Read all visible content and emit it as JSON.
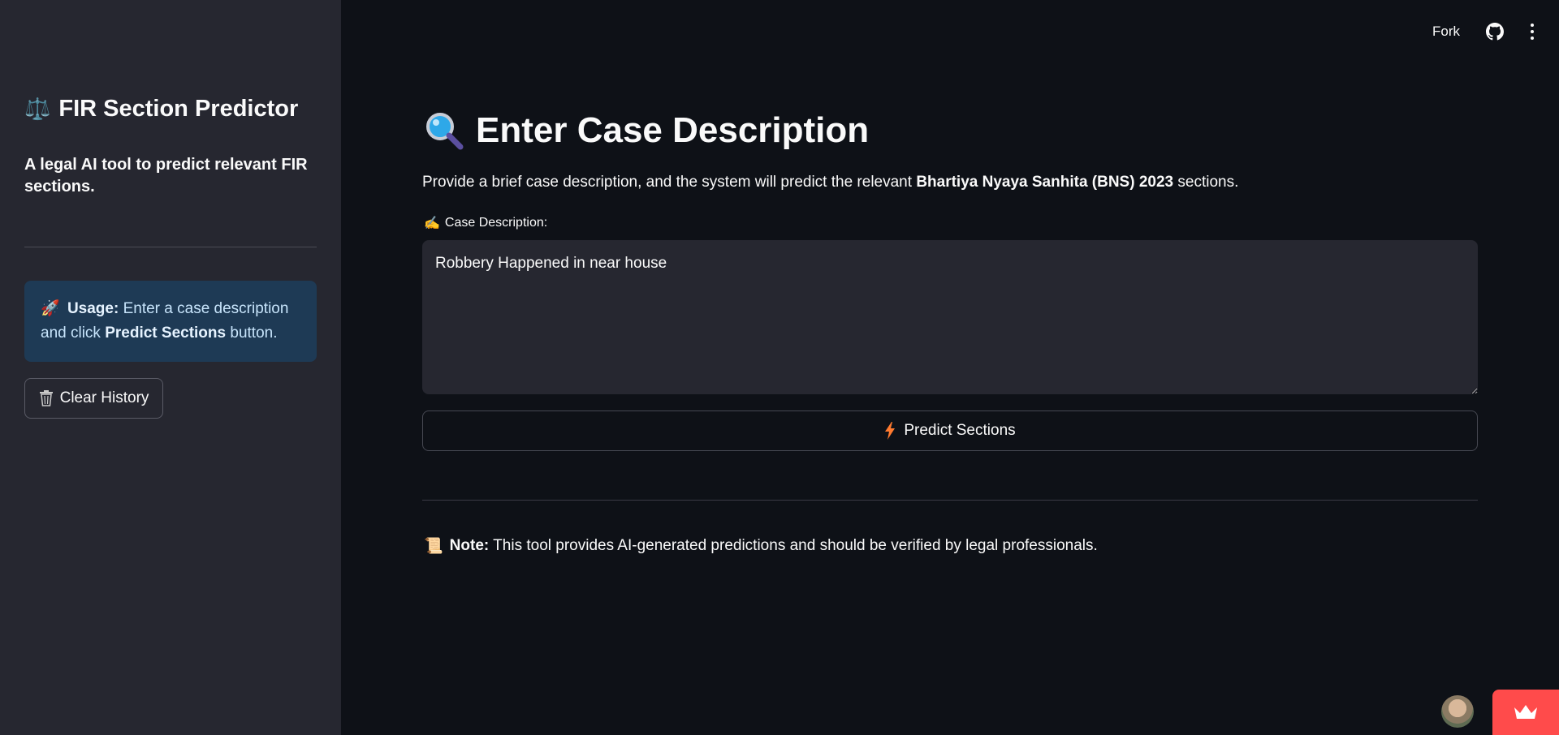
{
  "sidebar": {
    "title_emoji": "⚖️",
    "title": "FIR Section Predictor",
    "subtitle": "A legal AI tool to predict relevant FIR sections.",
    "usage": {
      "emoji": "🚀",
      "bold_label": "Usage:",
      "text_before": "Enter a case description and click",
      "bold_action": "Predict Sections",
      "text_after": "button."
    },
    "clear_button_label": "Clear History"
  },
  "topbar": {
    "fork_label": "Fork"
  },
  "main": {
    "title": "Enter Case Description",
    "description_prefix": "Provide a brief case description, and the system will predict the relevant",
    "description_bold": "Bhartiya Nyaya Sanhita (BNS) 2023",
    "description_suffix": "sections.",
    "field_label_emoji": "✍️",
    "field_label": "Case Description:",
    "case_text": "Robbery Happened in near house",
    "predict_button_label": "Predict Sections",
    "note_emoji": "📜",
    "note_bold": "Note:",
    "note_text": "This tool provides AI-generated predictions and should be verified by legal professionals."
  },
  "colors": {
    "background": "#0e1117",
    "sidebar": "#262730",
    "info_box": "#1e3a55",
    "accent_red": "#ff4b4b",
    "bolt_orange": "#ff7a2f"
  },
  "icons": [
    "balance-scale-icon",
    "rocket-icon",
    "trash-icon",
    "github-icon",
    "kebab-menu-icon",
    "magnifying-glass-icon",
    "writing-hand-icon",
    "lightning-icon",
    "scroll-icon",
    "avatar",
    "crown-icon"
  ]
}
